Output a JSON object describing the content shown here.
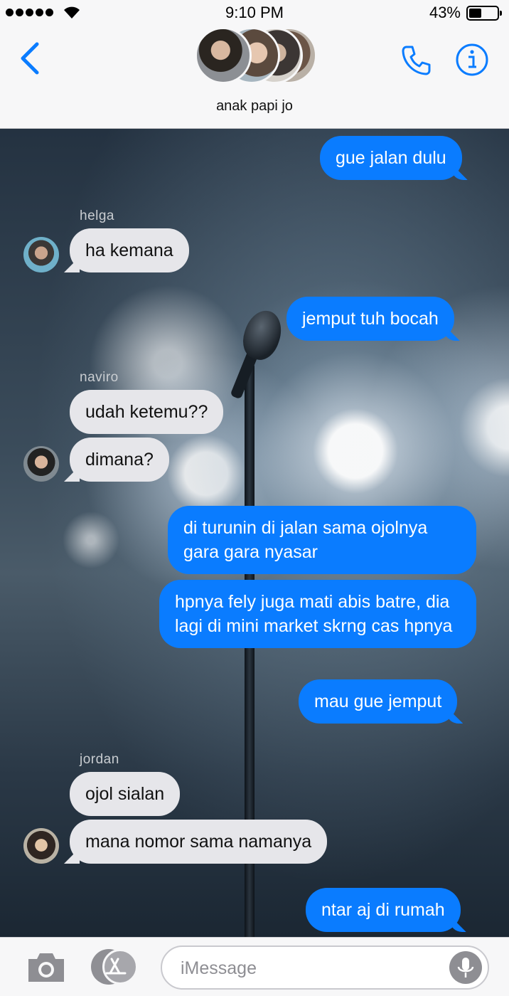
{
  "status_bar": {
    "time": "9:10 PM",
    "battery_percent": "43%",
    "battery_level": 0.43,
    "signal_dots": 5,
    "wifi_icon": "wifi-icon"
  },
  "header": {
    "group_name": "anak papi jo",
    "back_icon": "chevron-left-icon",
    "call_icon": "phone-icon",
    "info_icon": "info-icon",
    "accent_color": "#0a7cff"
  },
  "messages": [
    {
      "direction": "out",
      "text": "gue jalan dulu"
    },
    {
      "direction": "in",
      "sender": "helga",
      "text": "ha kemana"
    },
    {
      "direction": "out",
      "text": "jemput tuh bocah"
    },
    {
      "direction": "in",
      "sender": "naviro",
      "text": "udah ketemu??"
    },
    {
      "direction": "in",
      "text": "dimana?"
    },
    {
      "direction": "out",
      "text": "di turunin di jalan sama ojolnya gara gara nyasar"
    },
    {
      "direction": "out",
      "text": "hpnya fely juga mati abis batre, dia lagi di mini market skrng cas hpnya"
    },
    {
      "direction": "out",
      "text": "mau gue jemput"
    },
    {
      "direction": "in",
      "sender": "jordan",
      "text": "ojol sialan"
    },
    {
      "direction": "in",
      "text": "mana nomor sama namanya"
    },
    {
      "direction": "out",
      "text": "ntar aj di rumah"
    }
  ],
  "input_bar": {
    "placeholder": "iMessage",
    "camera_icon": "camera-icon",
    "apps_icon": "app-store-icon",
    "mic_icon": "microphone-icon"
  },
  "colors": {
    "outgoing_bubble": "#0a7cff",
    "incoming_bubble": "#e6e6ea"
  }
}
